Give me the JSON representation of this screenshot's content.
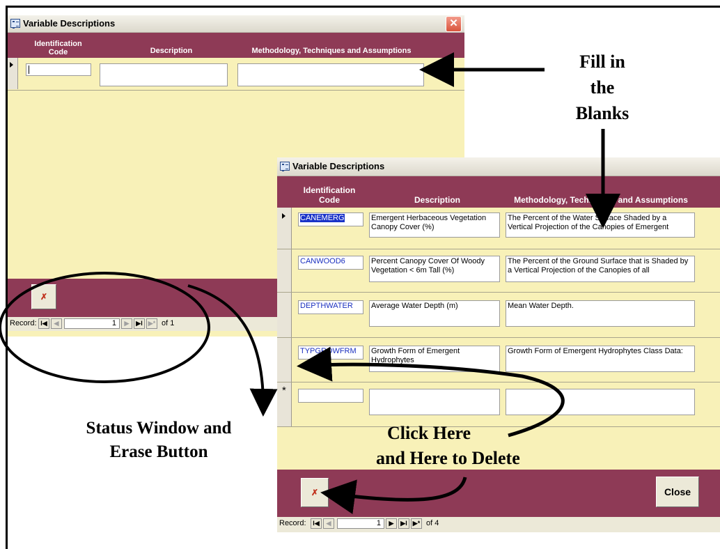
{
  "window_top": {
    "title": "Variable Descriptions",
    "close_glyph": "✕",
    "columns": {
      "code": "Identification Code",
      "description": "Description",
      "methodology": "Methodology, Techniques and Assumptions"
    },
    "record_label": "Record:",
    "record_number": "1",
    "record_of": "of 1"
  },
  "window_bottom": {
    "title": "Variable Descriptions",
    "columns": {
      "code": "Identification Code",
      "description": "Description",
      "methodology": "Methodology, Techniques and Assumptions"
    },
    "rows": [
      {
        "code": "CANEMERG",
        "description": "Emergent Herbaceous Vegetation Canopy Cover (%)",
        "methodology": "The Percent of the Water Surface Shaded by a Vertical Projection of the Canopies of Emergent"
      },
      {
        "code": "CANWOOD6",
        "description": "Percent Canopy Cover Of Woody Vegetation < 6m Tall (%)",
        "methodology": "The Percent of the Ground Surface that is Shaded by a Vertical Projection of the Canopies of all"
      },
      {
        "code": "DEPTHWATER",
        "description": "Average Water Depth (m)",
        "methodology": "Mean Water Depth."
      },
      {
        "code": "TYPGROWFRM",
        "description": "Growth Form of Emergent Hydrophytes",
        "methodology": "Growth Form of Emergent Hydrophytes Class Data:"
      }
    ],
    "close_label": "Close",
    "record_label": "Record:",
    "record_number": "1",
    "record_of": "of 4"
  },
  "nav_glyphs": {
    "first": "I◀",
    "prev": "◀",
    "next": "▶",
    "last": "▶I",
    "new": "▶*",
    "star": "*",
    "erase": "✗"
  },
  "annotations": {
    "fill_blanks": [
      "Fill in",
      "the",
      "Blanks"
    ],
    "status_window": [
      "Status Window and",
      "Erase Button"
    ],
    "click_here": [
      "Click Here",
      "and Here to Delete"
    ]
  }
}
